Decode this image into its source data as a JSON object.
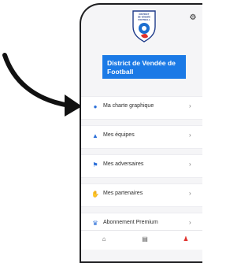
{
  "club": {
    "name": "District de Vendée de Football"
  },
  "logo": {
    "line1": "DISTRICT",
    "line2": "DE VENDÉE",
    "line3": "FOOTBALL"
  },
  "header": {
    "settings_icon": "gear-icon"
  },
  "menu": {
    "items": [
      {
        "label": "Ma charte graphique",
        "icon": "brush-icon"
      },
      {
        "label": "Mes équipes",
        "icon": "team-icon"
      },
      {
        "label": "Mes adversaires",
        "icon": "flag-icon"
      },
      {
        "label": "Mes partenaires",
        "icon": "handshake-icon"
      },
      {
        "label": "Abonnement Premium",
        "icon": "crown-icon"
      }
    ]
  },
  "tabbar": {
    "tabs": [
      {
        "icon": "home-icon"
      },
      {
        "icon": "document-icon"
      },
      {
        "icon": "user-icon"
      }
    ]
  },
  "colors": {
    "accent": "#1b7ae6",
    "active_tab": "#e0322d"
  }
}
